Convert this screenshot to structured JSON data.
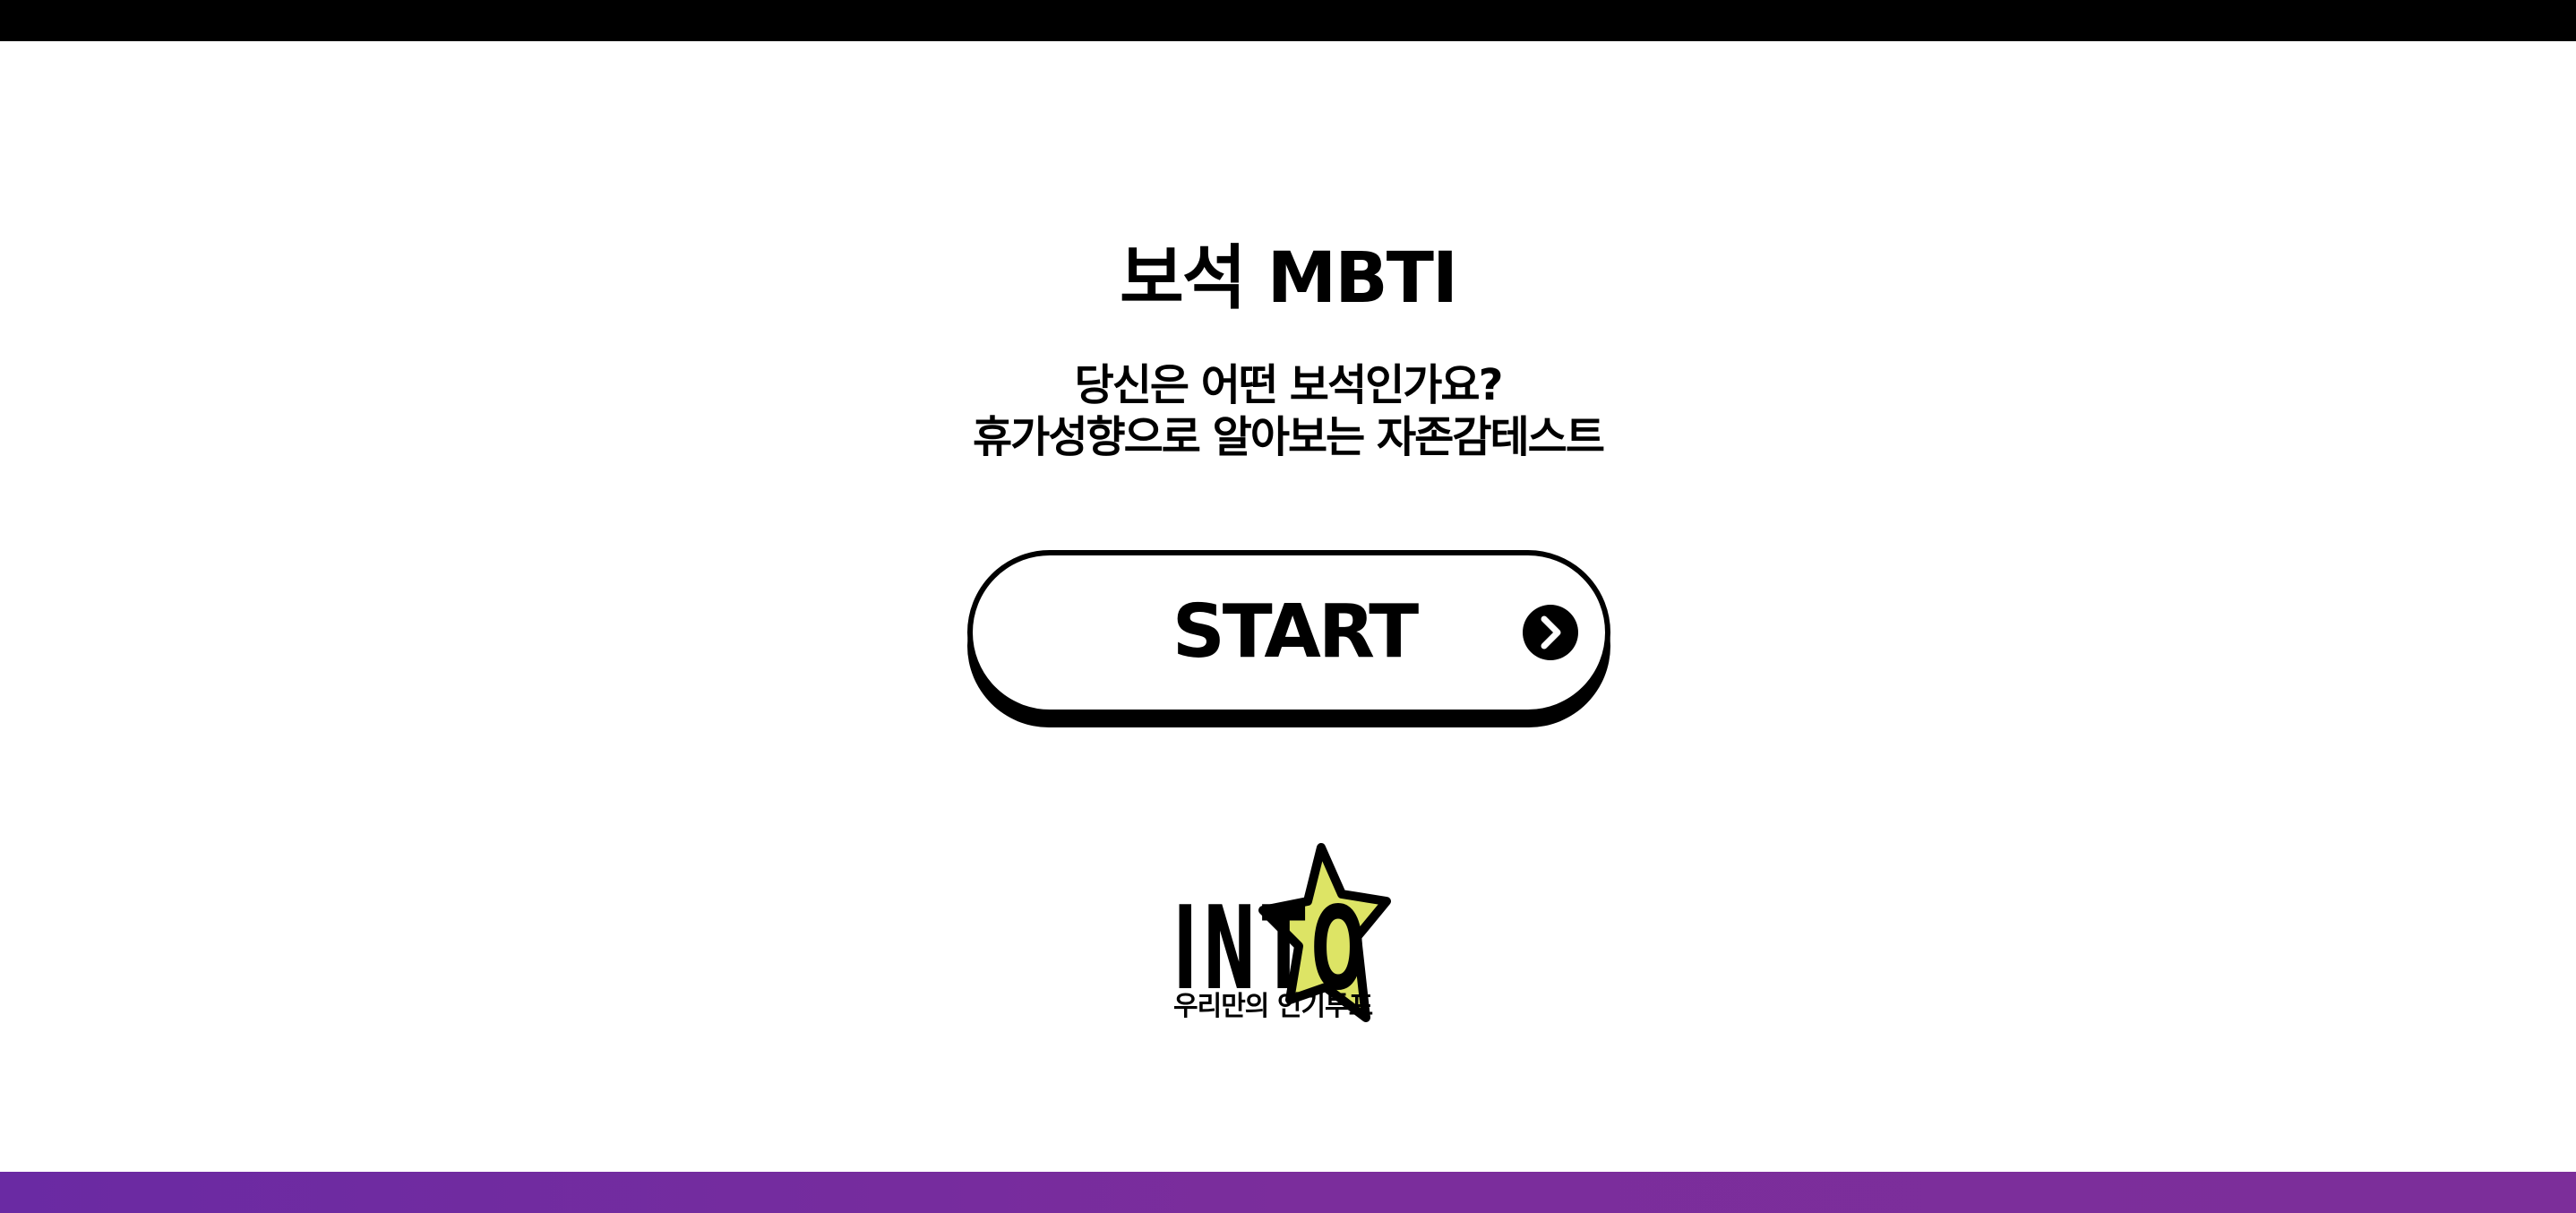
{
  "header": {
    "title": "보석 MBTI",
    "subtitle_line1": "당신은 어떤 보석인가요?",
    "subtitle_line2": "휴가성향으로 알아보는 자존감테스트"
  },
  "start_button": {
    "label": "START",
    "icon": "chevron-right-circle-icon"
  },
  "logo": {
    "brand": "INTO",
    "tagline": "우리만의 인기투표",
    "icon": "star-icon",
    "star_color": "#dde465"
  },
  "colors": {
    "top_bar": "#000000",
    "bottom_bar": "#7b2d9c",
    "background": "#ffffff",
    "text": "#000000"
  }
}
